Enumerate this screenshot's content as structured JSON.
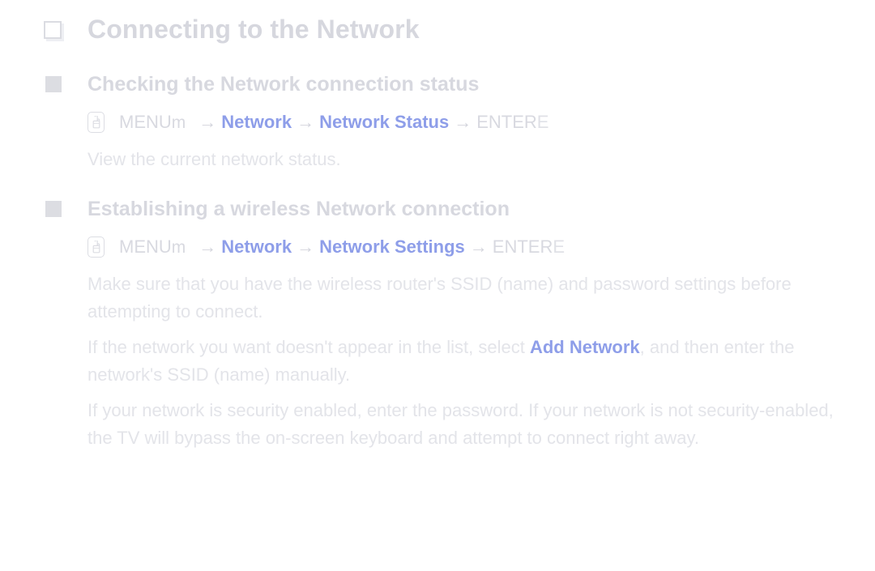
{
  "page": {
    "title": "Connecting to the Network",
    "title_bullet_icon": "hollow-square-bullet-icon"
  },
  "colors": {
    "background": "#ffffff",
    "heading_gray": "#d6d7de",
    "body_gray": "#e3e4e9",
    "accent_blue": "#8e9ee9",
    "bullet_gray": "#dcdde2"
  },
  "sections": [
    {
      "heading": "Checking the Network connection status",
      "bullet_icon": "filled-square-bullet-icon",
      "menu_path": {
        "icon": "remote-button-press-icon",
        "key_label": "MENU",
        "key_suffix": "m",
        "arrow": "→",
        "steps": [
          "Network",
          "Network Status"
        ],
        "enter_label": "ENTER",
        "enter_suffix": "E"
      },
      "paragraphs": [
        {
          "text": "View the current network status."
        }
      ]
    },
    {
      "heading": "Establishing a wireless Network connection",
      "bullet_icon": "filled-square-bullet-icon",
      "menu_path": {
        "icon": "remote-button-press-icon",
        "key_label": "MENU",
        "key_suffix": "m",
        "arrow": "→",
        "steps": [
          "Network",
          "Network Settings"
        ],
        "enter_label": "ENTER",
        "enter_suffix": "E"
      },
      "paragraphs": [
        {
          "text": "Make sure that you have the wireless router's SSID (name) and password settings before attempting to connect."
        },
        {
          "before": "If the network you want doesn't appear in the list, select ",
          "highlight": "Add Network",
          "after": ", and then enter the network's SSID (name) manually."
        },
        {
          "text": "If your network is security enabled, enter the password. If your network is not security-enabled, the TV will bypass the on-screen keyboard and attempt to connect right away."
        }
      ]
    }
  ]
}
